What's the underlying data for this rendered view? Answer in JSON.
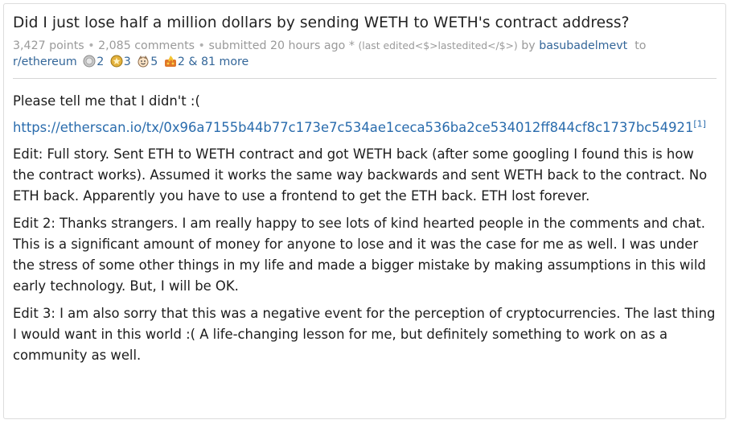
{
  "post": {
    "title": "Did I just lose half a million dollars by sending WETH to WETH's contract address?",
    "points": "3,427 points",
    "comments": "2,085 comments",
    "submitted": "submitted 20 hours ago",
    "edited_marker": "*",
    "last_edited": "(last edited<$>lastedited</$>)",
    "by": "by",
    "author": "basubadelmevt",
    "to": "to",
    "subreddit": "r/ethereum",
    "awards": [
      {
        "icon": "silver-award-icon",
        "count": "2"
      },
      {
        "icon": "gold-award-icon",
        "count": "3"
      },
      {
        "icon": "wholesome-award-icon",
        "count": "5"
      },
      {
        "icon": "fire-award-icon",
        "count": "2"
      }
    ],
    "more_awards": "& 81 more",
    "bullet": "•"
  },
  "body": {
    "p1": "Please tell me that I didn't :(",
    "url": "https://etherscan.io/tx/0x96a7155b44b77c173e7c534ae1ceca536ba2ce534012ff844cf8c1737bc54921",
    "footnote": "[1]",
    "p2": "Edit: Full story. Sent ETH to WETH contract and got WETH back (after some googling I found this is how the contract works). Assumed it works the same way backwards and sent WETH back to the contract. No ETH back. Apparently you have to use a frontend to get the ETH back. ETH lost forever.",
    "p3": "Edit 2: Thanks strangers. I am really happy to see lots of kind hearted people in the comments and chat. This is a significant amount of money for anyone to lose and it was the case for me as well. I was under the stress of some other things in my life and made a bigger mistake by making assumptions in this wild early technology. But, I will be OK.",
    "p4": "Edit 3: I am also sorry that this was a negative event for the perception of cryptocurrencies. The last thing I would want in this world :( A life-changing lesson for me, but definitely something to work on as a community as well."
  },
  "colors": {
    "link": "#336699",
    "url": "#2a6cad",
    "meta": "#9a9a9a",
    "border": "#dcdcdc"
  }
}
